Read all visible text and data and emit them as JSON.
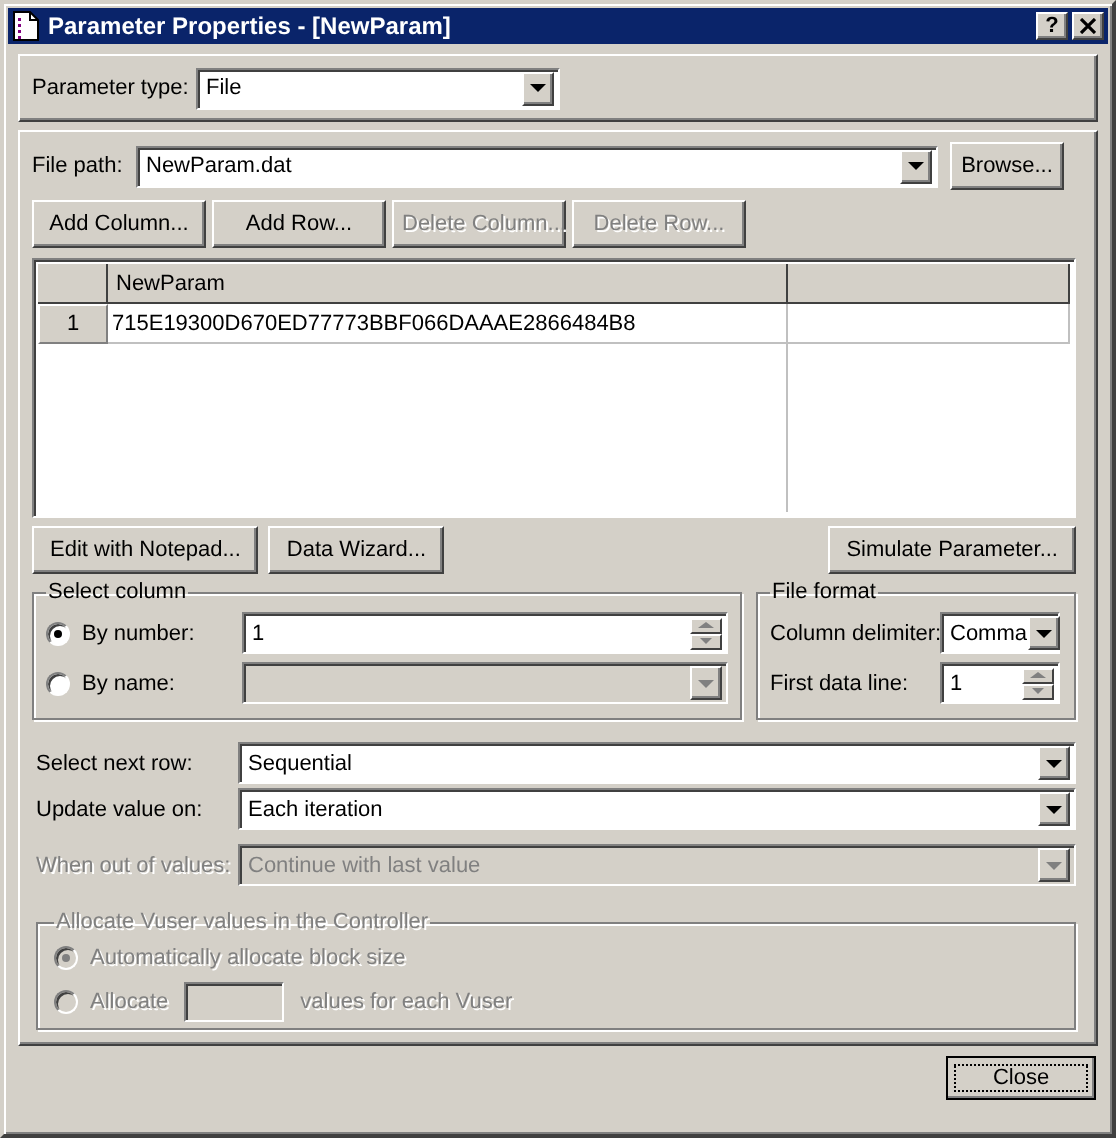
{
  "window": {
    "title": "Parameter Properties - [NewParam]",
    "help": "?"
  },
  "parameter_type": {
    "label": "Parameter type:",
    "value": "File"
  },
  "file_path": {
    "label": "File path:",
    "value": "NewParam.dat",
    "browse": "Browse..."
  },
  "table_buttons": [
    {
      "label": "Add Column...",
      "disabled": false
    },
    {
      "label": "Add Row...",
      "disabled": false
    },
    {
      "label": "Delete Column...",
      "disabled": true
    },
    {
      "label": "Delete Row...",
      "disabled": true
    }
  ],
  "table": {
    "columns": [
      "NewParam"
    ],
    "rows": [
      {
        "number": "1",
        "cells": [
          "715E19300D670ED77773BBF066DAAAE2866484B8"
        ]
      }
    ]
  },
  "action_buttons": [
    "Edit with Notepad...",
    "Data Wizard...",
    "Simulate Parameter..."
  ],
  "select_column": {
    "title": "Select column",
    "options": [
      {
        "label": "By number:",
        "selected": true,
        "kind": "spin",
        "value": "1"
      },
      {
        "label": "By name:",
        "selected": false,
        "kind": "combo",
        "disabled": true
      }
    ]
  },
  "file_format": {
    "title": "File format",
    "fields": [
      {
        "kind": "combo",
        "label": "Column delimiter:",
        "value": "Comma"
      },
      {
        "kind": "spin",
        "label": "First data line:",
        "value": "1"
      }
    ]
  },
  "row_settings": [
    {
      "label": "Select next row:",
      "value": "Sequential",
      "disabled": false
    },
    {
      "label": "Update value on:",
      "value": "Each iteration",
      "disabled": false
    },
    {
      "label": "When out of values:",
      "value": "Continue with last value",
      "disabled": true
    }
  ],
  "allocate": {
    "title": "Allocate Vuser values in the Controller",
    "disabled": true,
    "options": [
      {
        "kind": "plain",
        "label": "Automatically allocate block size",
        "selected": true
      },
      {
        "kind": "count",
        "label": "Allocate",
        "suffix": "values for each Vuser",
        "selected": false
      }
    ]
  },
  "close_button": "Close"
}
